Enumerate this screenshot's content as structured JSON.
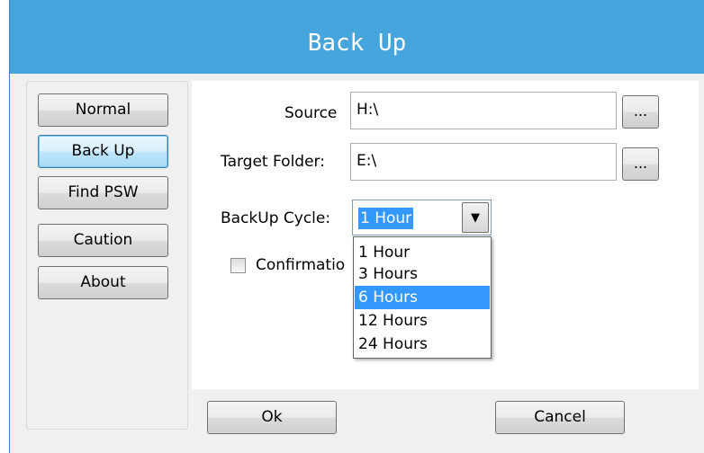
{
  "window": {
    "title": "Back Up"
  },
  "nav": {
    "items": [
      {
        "label": "Normal"
      },
      {
        "label": "Back Up"
      },
      {
        "label": "Find PSW"
      },
      {
        "label": "Caution"
      },
      {
        "label": "About"
      }
    ],
    "selected": "Back Up"
  },
  "form": {
    "source": {
      "label": "Source",
      "value": "H:\\",
      "browse": "..."
    },
    "target": {
      "label": "Target Folder:",
      "value": "E:\\",
      "browse": "..."
    },
    "cycle": {
      "label": "BackUp Cycle:",
      "value": "1 Hour",
      "options": [
        "1 Hour",
        "3 Hours",
        "6 Hours",
        "12 Hours",
        "24 Hours"
      ],
      "highlighted": "6 Hours"
    },
    "confirmation": {
      "label": "Confirmatio",
      "checked": false
    }
  },
  "footer": {
    "ok": "Ok",
    "cancel": "Cancel"
  },
  "colors": {
    "titlebar": "#45a5dc",
    "selection": "#3399ff"
  }
}
